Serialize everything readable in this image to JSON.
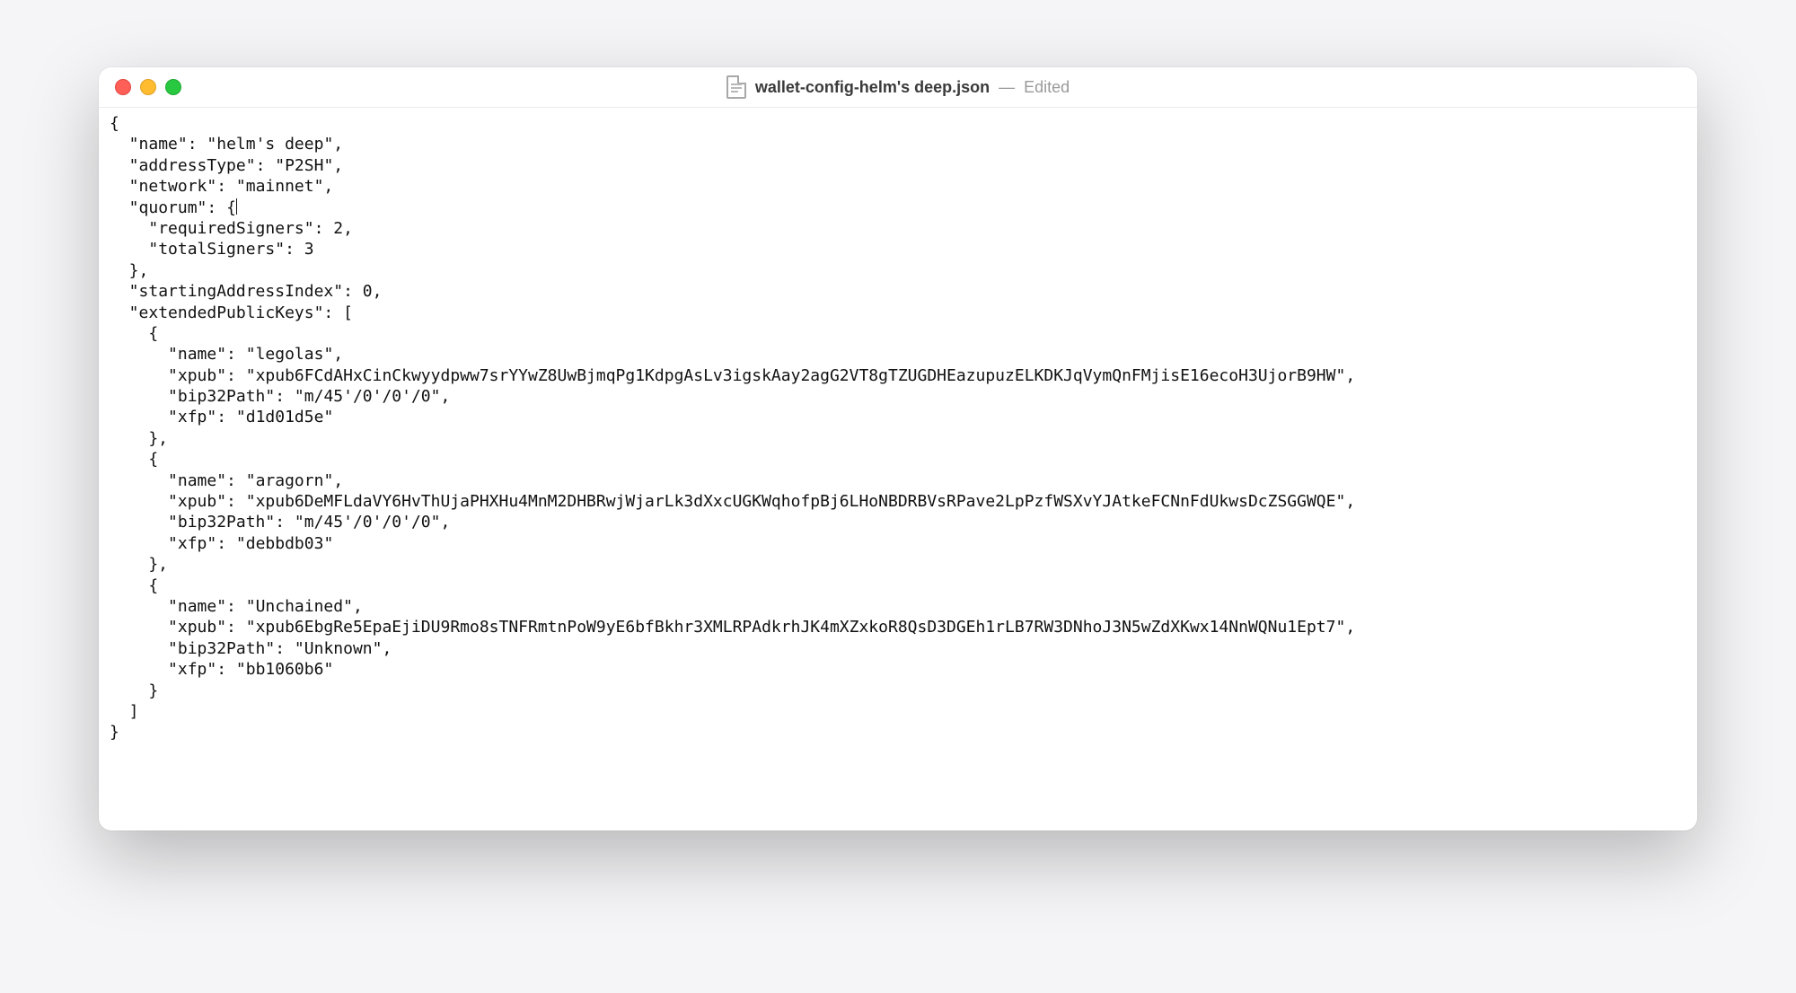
{
  "window": {
    "filename": "wallet-config-helm's deep.json",
    "separator": "—",
    "status": "Edited"
  },
  "doc": {
    "name": "helm's deep",
    "addressType": "P2SH",
    "network": "mainnet",
    "quorum_open": "{",
    "quorum": {
      "requiredSigners": "2",
      "totalSigners": "3"
    },
    "startingAddressIndex": "0",
    "keys": [
      {
        "name": "legolas",
        "xpub": "xpub6FCdAHxCinCkwyydpww7srYYwZ8UwBjmqPg1KdpgAsLv3igskAay2agG2VT8gTZUGDHEazupuzELKDKJqVymQnFMjisE16ecoH3UjorB9HW",
        "bip32Path": "m/45'/0'/0'/0",
        "xfp": "d1d01d5e"
      },
      {
        "name": "aragorn",
        "xpub": "xpub6DeMFLdaVY6HvThUjaPHXHu4MnM2DHBRwjWjarLk3dXxcUGKWqhofpBj6LHoNBDRBVsRPave2LpPzfWSXvYJAtkeFCNnFdUkwsDcZSGGWQE",
        "bip32Path": "m/45'/0'/0'/0",
        "xfp": "debbdb03"
      },
      {
        "name": "Unchained",
        "xpub": "xpub6EbgRe5EpaEjiDU9Rmo8sTNFRmtnPoW9yE6bfBkhr3XMLRPAdkrhJK4mXZxkoR8QsD3DGEh1rLB7RW3DNhoJ3N5wZdXKwx14NnWQNu1Ept7",
        "bip32Path": "Unknown",
        "xfp": "bb1060b6"
      }
    ]
  },
  "labels": {
    "name": "name",
    "addressType": "addressType",
    "network": "network",
    "quorum": "quorum",
    "requiredSigners": "requiredSigners",
    "totalSigners": "totalSigners",
    "startingAddressIndex": "startingAddressIndex",
    "extendedPublicKeys": "extendedPublicKeys",
    "xpub": "xpub",
    "bip32Path": "bip32Path",
    "xfp": "xfp"
  }
}
